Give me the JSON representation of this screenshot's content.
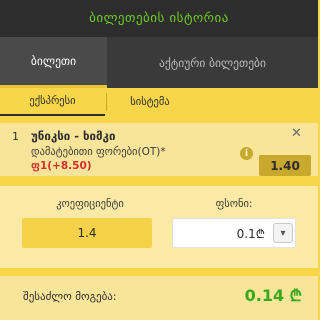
{
  "header": {
    "title": "ბილეთების ისტორია"
  },
  "tabs": [
    {
      "label": "ბილეთი",
      "active": true
    },
    {
      "label": "აქტიური ბილეთები",
      "active": false
    }
  ],
  "subtabs": [
    {
      "label": "ექსპრესი",
      "active": true
    },
    {
      "label": "სისტემა",
      "active": false
    }
  ],
  "ticket": {
    "number": "1",
    "match": "უნიკსი - ხიმკი",
    "market": "დამატებითი ფორები(OT)*",
    "pick": "ფ1(+8.50)",
    "odds": "1.40",
    "close_icon": "close-icon",
    "info_icon": "info-icon"
  },
  "calc": {
    "coef_label": "კოეფიციენტი",
    "coef_value": "1.4",
    "stake_label": "ფსონი:",
    "stake_value": "0.1₾"
  },
  "win": {
    "label": "შესაძლო მოგება:",
    "value": "0.14 ₾"
  },
  "colors": {
    "accent_green": "#6fcf1e",
    "win_green": "#3aa81f",
    "yellow": "#f7d64a",
    "dark": "#2d2d2d",
    "red": "#d32f2f"
  }
}
